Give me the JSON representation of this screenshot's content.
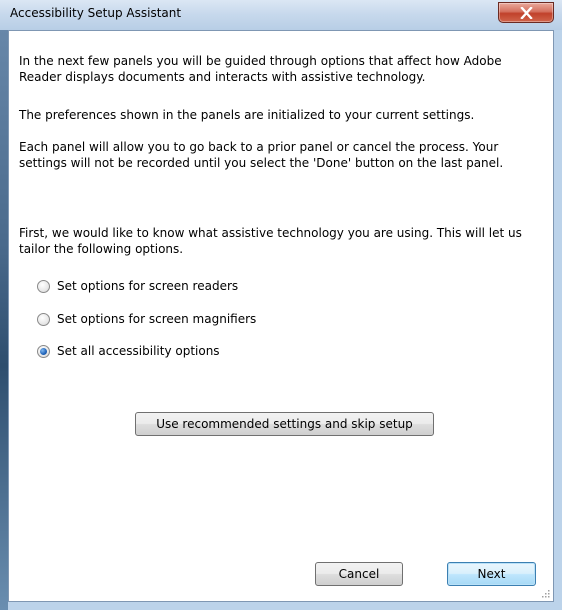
{
  "window": {
    "title": "Accessibility Setup Assistant"
  },
  "intro": {
    "p1": "In the next few panels you will be guided through options that affect how Adobe Reader displays documents and interacts with assistive technology.",
    "p2": "The preferences shown in the panels are initialized to your current settings.",
    "p3": "Each panel will allow you to go back to a prior panel or cancel the process. Your settings will not be recorded until you select the 'Done' button on the last panel."
  },
  "question": {
    "text": "First, we would like to know what assistive technology you are using. This will let us tailor the following options."
  },
  "options": [
    {
      "label": "Set options for screen readers",
      "checked": false
    },
    {
      "label": "Set options for screen magnifiers",
      "checked": false
    },
    {
      "label": "Set all accessibility options",
      "checked": true
    }
  ],
  "buttons": {
    "skip_label": "Use recommended settings and skip setup",
    "cancel_label": "Cancel",
    "next_label": "Next"
  },
  "colors": {
    "titlebar": "#c6d8ec",
    "close_button": "#c0412b",
    "default_button_border": "#3c7fb1"
  }
}
